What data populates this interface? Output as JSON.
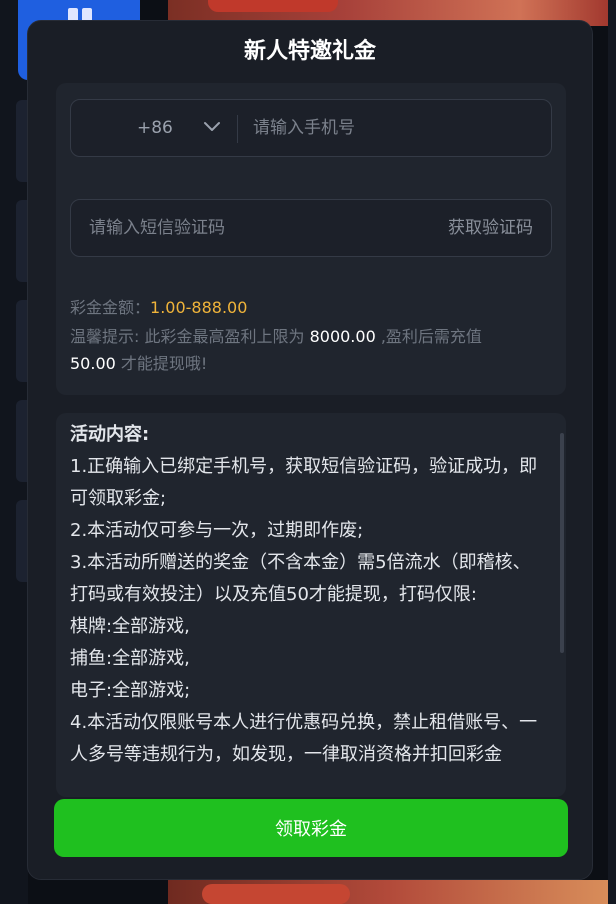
{
  "modal": {
    "title": "新人特邀礼金",
    "phone": {
      "country_code": "+86",
      "placeholder": "请输入手机号",
      "value": ""
    },
    "sms": {
      "placeholder": "请输入短信验证码",
      "value": "",
      "get_code_label": "获取验证码"
    },
    "bonus": {
      "label": "彩金金额：",
      "value": "1.00-888.00"
    },
    "tip": {
      "prefix": "温馨提示: 此彩金最高盈利上限为 ",
      "max_profit": "8000.00",
      "middle": " ,盈利后需充值",
      "recharge": "50.00",
      "suffix": " 才能提现哦!"
    },
    "description": {
      "heading": "活动内容:",
      "lines": [
        "1.正确输入已绑定手机号，获取短信验证码，验证成功，即可领取彩金;",
        "2.本活动仅可参与一次，过期即作废;",
        "3.本活动所赠送的奖金（不含本金）需5倍流水（即稽核、打码或有效投注）以及充值50才能提现，打码仅限:",
        "棋牌:全部游戏,",
        "捕鱼:全部游戏,",
        "电子:全部游戏;",
        "4.本活动仅限账号本人进行优惠码兑换，禁止租借账号、一人多号等违规行为，如发现，一律取消资格并扣回彩金"
      ]
    },
    "claim_button": "领取彩金"
  },
  "colors": {
    "accent_green": "#1fc01f",
    "amount_orange": "#f0b43a",
    "modal_bg": "#1a1e26",
    "panel_bg": "#20252e"
  },
  "icons": {
    "country_dropdown": "chevron-down-icon"
  }
}
